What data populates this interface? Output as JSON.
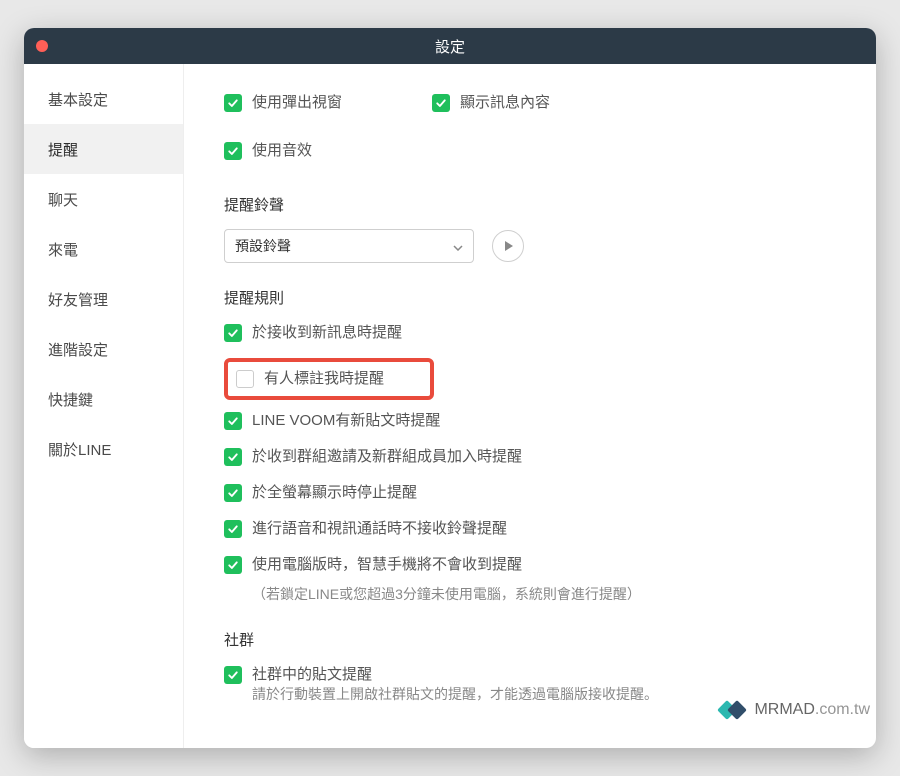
{
  "window": {
    "title": "設定"
  },
  "sidebar": {
    "items": [
      {
        "label": "基本設定",
        "active": false
      },
      {
        "label": "提醒",
        "active": true
      },
      {
        "label": "聊天",
        "active": false
      },
      {
        "label": "來電",
        "active": false
      },
      {
        "label": "好友管理",
        "active": false
      },
      {
        "label": "進階設定",
        "active": false
      },
      {
        "label": "快捷鍵",
        "active": false
      },
      {
        "label": "關於LINE",
        "active": false
      }
    ]
  },
  "top_checks": {
    "popup": "使用彈出視窗",
    "show_content": "顯示訊息內容",
    "use_sound": "使用音效"
  },
  "ringtone": {
    "heading": "提醒鈴聲",
    "selected": "預設鈴聲"
  },
  "rules": {
    "heading": "提醒規則",
    "items": [
      {
        "label": "於接收到新訊息時提醒",
        "checked": true
      },
      {
        "label": "有人標註我時提醒",
        "checked": false,
        "highlighted": true
      },
      {
        "label": "LINE VOOM有新貼文時提醒",
        "checked": true
      },
      {
        "label": "於收到群組邀請及新群組成員加入時提醒",
        "checked": true
      },
      {
        "label": "於全螢幕顯示時停止提醒",
        "checked": true
      },
      {
        "label": "進行語音和視訊通話時不接收鈴聲提醒",
        "checked": true
      },
      {
        "label": "使用電腦版時，智慧手機將不會收到提醒",
        "checked": true,
        "sub": "（若鎖定LINE或您超過3分鐘未使用電腦，系統則會進行提醒）"
      }
    ]
  },
  "community": {
    "heading": "社群",
    "item_label": "社群中的貼文提醒",
    "item_sub": "請於行動裝置上開啟社群貼文的提醒，才能透過電腦版接收提醒。"
  },
  "watermark": {
    "brand": "MRMAD",
    "domain": ".com.tw"
  }
}
